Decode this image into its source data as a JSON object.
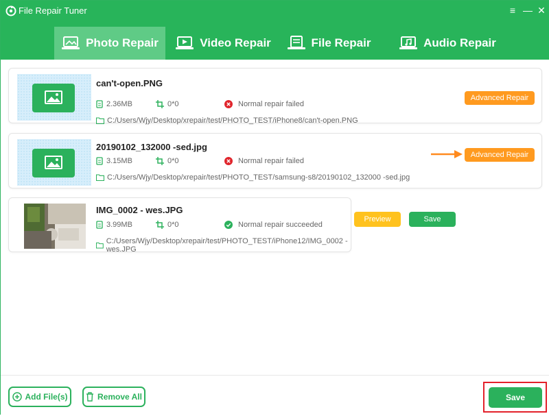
{
  "app": {
    "title": "File Repair Tuner",
    "accent": "#28b45a",
    "window_controls": [
      "menu-icon",
      "minimize-icon",
      "close-icon"
    ],
    "window_control_glyphs": [
      "≡",
      "—",
      "✕"
    ]
  },
  "tabs": [
    {
      "label": "Photo Repair",
      "icon": "photo-icon",
      "active": true
    },
    {
      "label": "Video Repair",
      "icon": "video-icon",
      "active": false
    },
    {
      "label": "File Repair",
      "icon": "file-icon",
      "active": false
    },
    {
      "label": "Audio Repair",
      "icon": "audio-icon",
      "active": false
    }
  ],
  "files": [
    {
      "name": "can't-open.PNG",
      "size": "2.36MB",
      "resolution": "0*0",
      "status": "Normal repair failed",
      "status_type": "failed",
      "path": "C:/Users/Wjy/Desktop/xrepair/test/PHOTO_TEST/iPhone8/can't-open.PNG",
      "action": "Advanced Repair"
    },
    {
      "name": "20190102_132000 -sed.jpg",
      "size": "3.15MB",
      "resolution": "0*0",
      "status": "Normal repair failed",
      "status_type": "failed",
      "path": "C:/Users/Wjy/Desktop/xrepair/test/PHOTO_TEST/samsung-s8/20190102_132000 -sed.jpg",
      "action": "Advanced Repair"
    },
    {
      "name": "IMG_0002 - wes.JPG",
      "size": "3.99MB",
      "resolution": "0*0",
      "status": "Normal repair succeeded",
      "status_type": "success",
      "path": "C:/Users/Wjy/Desktop/xrepair/test/PHOTO_TEST/iPhone12/IMG_0002 - wes.JPG",
      "preview_label": "Preview",
      "save_label": "Save"
    }
  ],
  "footer": {
    "add_files": "Add File(s)",
    "remove_all": "Remove All",
    "save": "Save"
  },
  "colors": {
    "orange": "#ff9a1f",
    "yellow": "#ffc21e",
    "green": "#2bb15c",
    "error": "#e0252c",
    "highlight": "#e3202a"
  }
}
